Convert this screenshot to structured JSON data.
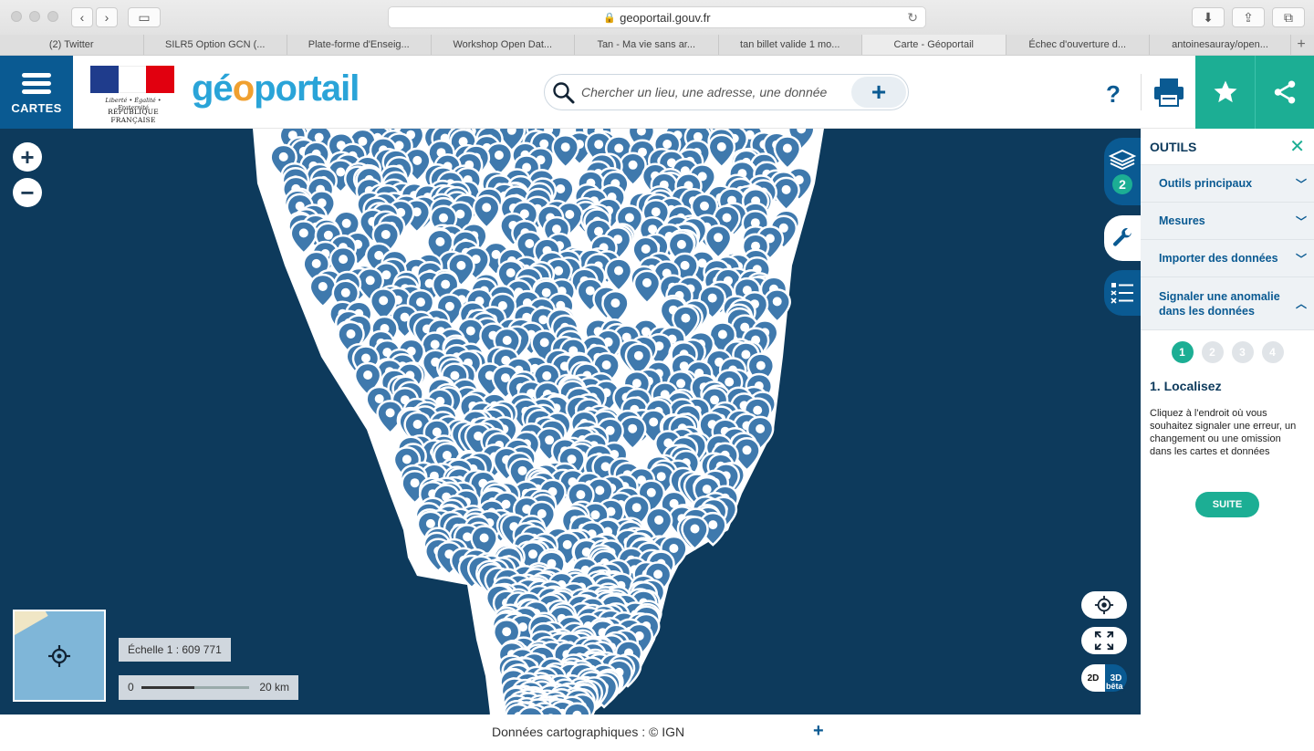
{
  "browser": {
    "url": "geoportail.gouv.fr",
    "tabs": [
      {
        "label": "(2) Twitter",
        "active": false
      },
      {
        "label": "SILR5 Option GCN (...",
        "active": false
      },
      {
        "label": "Plate-forme d'Enseig...",
        "active": false
      },
      {
        "label": "Workshop Open Dat...",
        "active": false
      },
      {
        "label": "Tan - Ma vie sans ar...",
        "active": false
      },
      {
        "label": "tan billet valide 1 mo...",
        "active": false
      },
      {
        "label": "Carte - Géoportail",
        "active": true
      },
      {
        "label": "Échec d'ouverture d...",
        "active": false
      },
      {
        "label": "antoinesauray/open...",
        "active": false
      }
    ]
  },
  "header": {
    "menu_label": "CARTES",
    "marianne_devise": "Liberté • Égalité • Fraternité",
    "marianne_republic": "RÉPUBLIQUE FRANÇAISE",
    "logo_parts": [
      "gé",
      "o",
      "portail"
    ],
    "search_placeholder": "Chercher un lieu, une adresse, une donnée",
    "search_add": "+",
    "help": "?"
  },
  "map": {
    "zoom_in": "+",
    "zoom_out": "−",
    "scale_text": "Échelle 1 : 609 771",
    "scalebar_start": "0",
    "scalebar_end": "20 km",
    "layers_count": "2",
    "toggle_2d": "2D",
    "toggle_3d": "3D",
    "toggle_beta": "bêta",
    "attribution": "Données cartographiques : ©  IGN",
    "attribution_more": "+"
  },
  "panel": {
    "title": "OUTILS",
    "close": "✕",
    "sections": [
      {
        "label": "Outils principaux",
        "expanded": false
      },
      {
        "label": "Mesures",
        "expanded": false
      },
      {
        "label": "Importer des données",
        "expanded": false
      },
      {
        "label": "Signaler une anomalie dans les données",
        "expanded": true
      }
    ],
    "steps": [
      "1",
      "2",
      "3",
      "4"
    ],
    "active_step": "1",
    "step_title": "1. Localisez",
    "step_text": "Cliquez à l'endroit où vous souhaitez signaler une erreur, un changement ou une omission dans les cartes et données",
    "next_label": "SUITE"
  },
  "colors": {
    "brand_blue": "#0a5a92",
    "accent_green": "#1cae94",
    "map_background": "#0d3a5c",
    "pin": "#3f79ad"
  },
  "icons": [
    "search-icon",
    "plus-icon",
    "help-icon",
    "print-icon",
    "star-icon",
    "share-icon",
    "layers-icon",
    "wrench-icon",
    "legend-icon",
    "geolocate-icon",
    "fullscreen-icon",
    "close-icon",
    "chevron-down-icon",
    "chevron-up-icon"
  ]
}
